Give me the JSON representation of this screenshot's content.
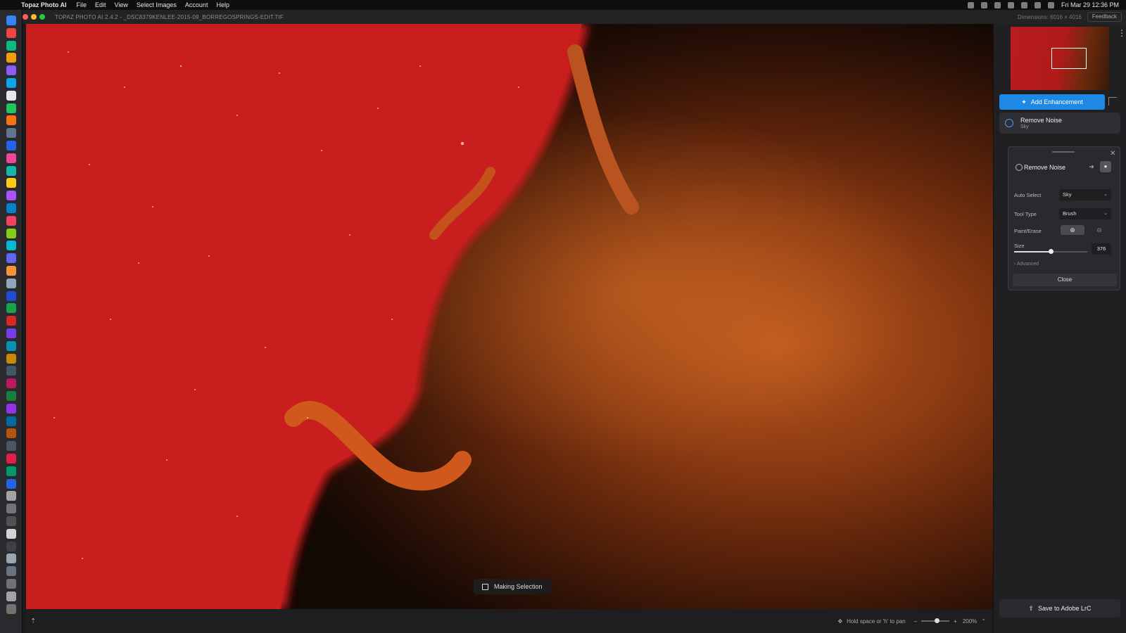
{
  "menubar": {
    "app_name": "Topaz Photo AI",
    "menus": [
      "File",
      "Edit",
      "View",
      "Select Images",
      "Account",
      "Help"
    ],
    "clock": "Fri Mar 29  12:36 PM"
  },
  "window": {
    "title": "TOPAZ PHOTO AI 2.4.2 - _DSC8379KENLEE-2015-09_BORREGOSPRINGS-EDIT.TIF",
    "dimensions": "Dimensions: 6016 × 4016",
    "feedback_label": "Feedback"
  },
  "canvas": {
    "status_label": "Making Selection"
  },
  "statusbar": {
    "pan_hint": "Hold space or 'h' to pan",
    "zoom_minus": "–",
    "zoom_plus": "+",
    "zoom_level": "200%",
    "zoom_fraction": 0.55
  },
  "panel": {
    "add_enhancement_label": "Add Enhancement",
    "enhancement_item": {
      "title": "Remove Noise",
      "subtitle": "Sky"
    },
    "tool": {
      "title": "Remove Noise",
      "auto_select_label": "Auto Select",
      "auto_select_value": "Sky",
      "tool_type_label": "Tool Type",
      "tool_type_value": "Brush",
      "paint_erase_label": "Paint/Erase",
      "size_label": "Size",
      "size_value": "376",
      "size_fraction": 0.5,
      "advanced_label": "› Advanced",
      "close_label": "Close"
    },
    "save_label": "Save to Adobe LrC"
  },
  "colors": {
    "accent": "#1e88e5",
    "mask_red": "#c81e1e"
  }
}
